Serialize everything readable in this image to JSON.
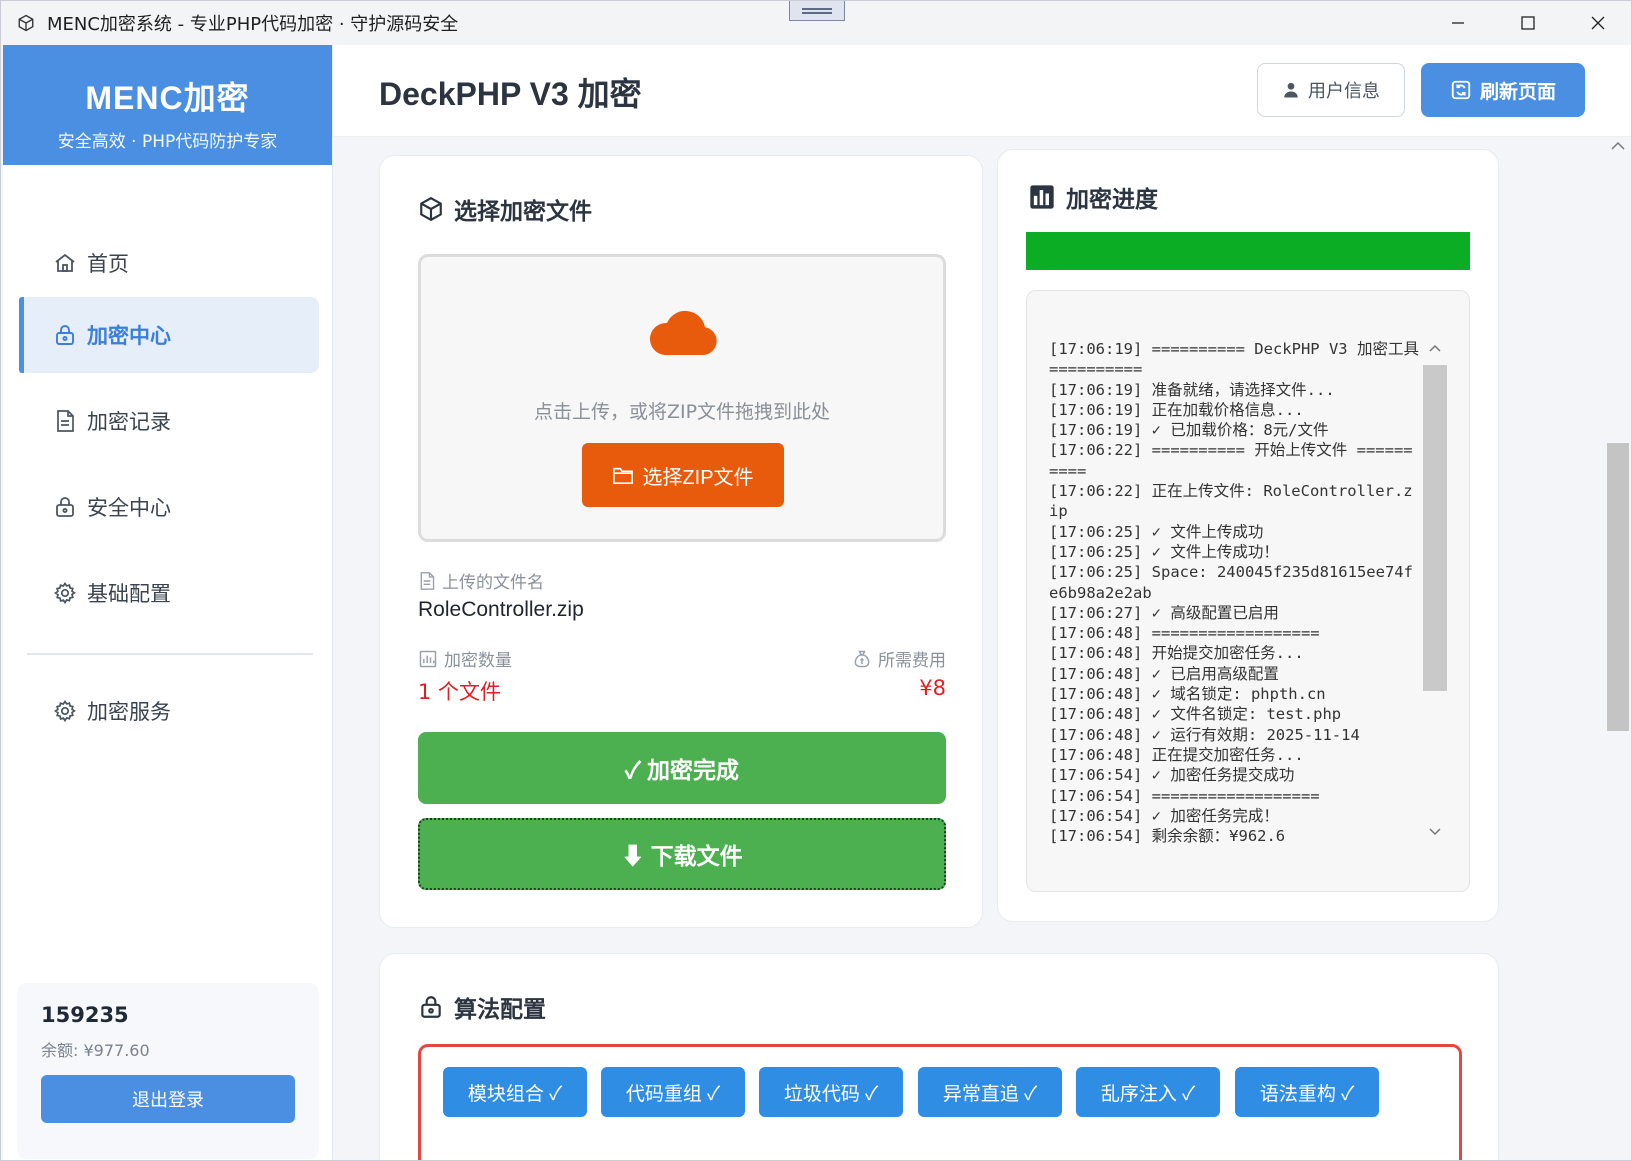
{
  "window": {
    "title": "MENC加密系统 - 专业PHP代码加密 · 守护源码安全"
  },
  "sidebar": {
    "brand_name": "MENC加密",
    "brand_sub": "安全高效 · PHP代码防护专家",
    "items": [
      {
        "label": "首页",
        "icon": "home-icon"
      },
      {
        "label": "加密中心",
        "icon": "lock-icon",
        "active": true
      },
      {
        "label": "加密记录",
        "icon": "document-icon"
      },
      {
        "label": "安全中心",
        "icon": "lock-icon"
      },
      {
        "label": "基础配置",
        "icon": "gear-icon"
      },
      {
        "label": "加密服务",
        "icon": "gear-icon"
      }
    ],
    "user": {
      "id": "159235",
      "balance": "余额: ¥977.60",
      "logout_label": "退出登录"
    }
  },
  "header": {
    "title": "DeckPHP V3 加密",
    "user_info_label": "用户信息",
    "refresh_label": "刷新页面"
  },
  "upload": {
    "title": "选择加密文件",
    "drop_hint": "点击上传，或将ZIP文件拖拽到此处",
    "choose_label": "选择ZIP文件",
    "filename_label": "上传的文件名",
    "filename": "RoleController.zip",
    "count_label": "加密数量",
    "count_value": "1 个文件",
    "cost_label": "所需费用",
    "cost_value": "¥8",
    "done_label": "✓ 加密完成",
    "download_label": "⬇ 下载文件"
  },
  "progress": {
    "title": "加密进度",
    "percent": 100,
    "fill_color": "#0aad24",
    "log": [
      "[17:06:19] ========== DeckPHP V3 加密工具 ==========",
      "[17:06:19] 准备就绪，请选择文件...",
      "[17:06:19] 正在加载价格信息...",
      "[17:06:19] ✓ 已加载价格：8元/文件",
      "[17:06:22] ========== 开始上传文件 ==========",
      "[17:06:22] 正在上传文件: RoleController.zip",
      "[17:06:25] ✓ 文件上传成功",
      "[17:06:25] ✓ 文件上传成功！",
      "[17:06:25] Space: 240045f235d81615ee74fe6b98a2e2ab",
      "[17:06:27] ✓ 高级配置已启用",
      "[17:06:48] ==================",
      "[17:06:48] 开始提交加密任务...",
      "[17:06:48] ✓ 已启用高级配置",
      "[17:06:48] ✓ 域名锁定: phpth.cn",
      "[17:06:48] ✓ 文件名锁定: test.php",
      "[17:06:48] ✓ 运行有效期: 2025-11-14",
      "[17:06:48] 正在提交加密任务...",
      "[17:06:54] ✓ 加密任务提交成功",
      "[17:06:54] ==================",
      "[17:06:54] ✓ 加密任务完成！",
      "[17:06:54] 剩余余额：¥962.6"
    ]
  },
  "algo": {
    "title": "算法配置",
    "options": [
      "模块组合 ✓",
      "代码重组 ✓",
      "垃圾代码 ✓",
      "异常直追 ✓",
      "乱序注入 ✓",
      "语法重构 ✓"
    ]
  },
  "colors": {
    "brand": "#4a8fe2",
    "upload_button": "#e85a0c",
    "success": "#4caf50",
    "danger_text": "#e02020",
    "algo_button": "#2f8de4",
    "algo_border": "#e5463d"
  }
}
